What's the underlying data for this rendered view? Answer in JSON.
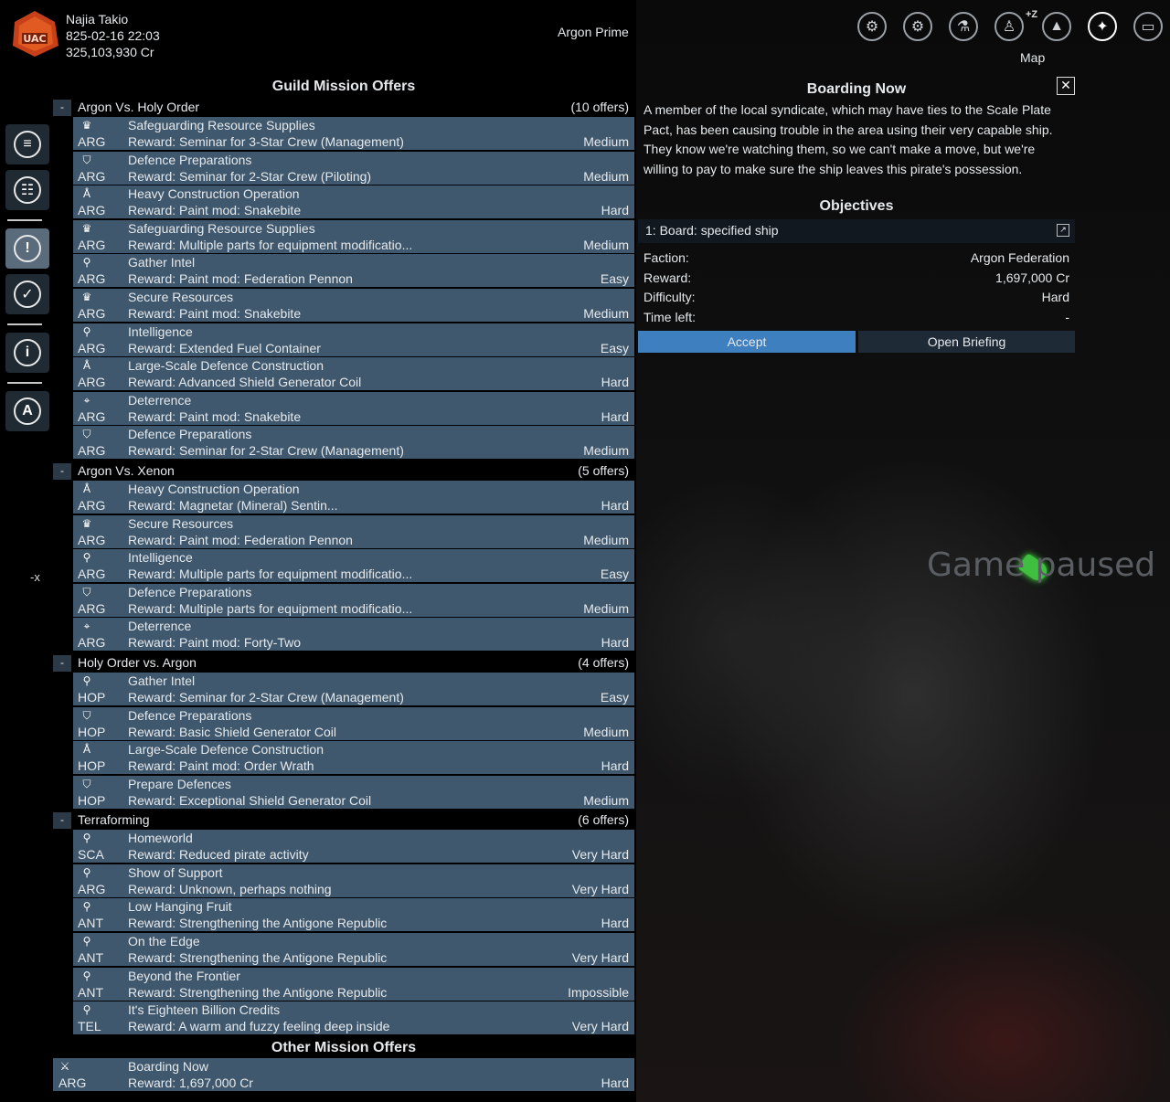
{
  "header": {
    "player_name": "Najia Takio",
    "datetime": "825-02-16 22:03",
    "credits": "325,103,930 Cr",
    "location": "Argon Prime",
    "map_label": "Map",
    "tz_label": "+Z"
  },
  "sidebar": {
    "x_label": "-x"
  },
  "guild": {
    "title": "Guild Mission Offers",
    "groups": [
      {
        "name": "Argon Vs. Holy Order",
        "count": "(10 offers)",
        "rows": [
          {
            "icon": "shield-crown",
            "name": "Safeguarding Resource Supplies",
            "faction": "ARG",
            "reward": "Reward: Seminar for 3-Star Crew (Management)",
            "difficulty": "Medium"
          },
          {
            "icon": "shield",
            "name": "Defence Preparations",
            "faction": "ARG",
            "reward": "Reward: Seminar for 2-Star Crew (Piloting)",
            "difficulty": "Medium"
          },
          {
            "icon": "build",
            "name": "Heavy Construction Operation",
            "faction": "ARG",
            "reward": "Reward: Paint mod: Snakebite",
            "difficulty": "Hard"
          },
          {
            "icon": "shield-crown",
            "name": "Safeguarding Resource Supplies",
            "faction": "ARG",
            "reward": "Reward: Multiple parts for equipment modificatio...",
            "difficulty": "Medium"
          },
          {
            "icon": "bulb",
            "name": "Gather Intel",
            "faction": "ARG",
            "reward": "Reward: Paint mod: Federation Pennon",
            "difficulty": "Easy"
          },
          {
            "icon": "shield-crown",
            "name": "Secure Resources",
            "faction": "ARG",
            "reward": "Reward: Paint mod: Snakebite",
            "difficulty": "Medium"
          },
          {
            "icon": "bulb",
            "name": "Intelligence",
            "faction": "ARG",
            "reward": "Reward: Extended Fuel Container",
            "difficulty": "Easy"
          },
          {
            "icon": "build",
            "name": "Large-Scale Defence Construction",
            "faction": "ARG",
            "reward": "Reward: Advanced Shield Generator Coil",
            "difficulty": "Hard"
          },
          {
            "icon": "crosshair",
            "name": "Deterrence",
            "faction": "ARG",
            "reward": "Reward: Paint mod: Snakebite",
            "difficulty": "Hard"
          },
          {
            "icon": "shield",
            "name": "Defence Preparations",
            "faction": "ARG",
            "reward": "Reward: Seminar for 2-Star Crew (Management)",
            "difficulty": "Medium"
          }
        ]
      },
      {
        "name": "Argon Vs. Xenon",
        "count": "(5 offers)",
        "rows": [
          {
            "icon": "build",
            "name": "Heavy Construction Operation",
            "faction": "ARG",
            "reward": "Reward: Magnetar (Mineral) Sentin...",
            "difficulty": "Hard"
          },
          {
            "icon": "shield-crown",
            "name": "Secure Resources",
            "faction": "ARG",
            "reward": "Reward: Paint mod: Federation Pennon",
            "difficulty": "Medium"
          },
          {
            "icon": "bulb",
            "name": "Intelligence",
            "faction": "ARG",
            "reward": "Reward: Multiple parts for equipment modificatio...",
            "difficulty": "Easy"
          },
          {
            "icon": "shield",
            "name": "Defence Preparations",
            "faction": "ARG",
            "reward": "Reward: Multiple parts for equipment modificatio...",
            "difficulty": "Medium"
          },
          {
            "icon": "crosshair",
            "name": "Deterrence",
            "faction": "ARG",
            "reward": "Reward: Paint mod: Forty-Two",
            "difficulty": "Hard"
          }
        ]
      },
      {
        "name": "Holy Order vs. Argon",
        "count": "(4 offers)",
        "rows": [
          {
            "icon": "bulb",
            "name": "Gather Intel",
            "faction": "HOP",
            "reward": "Reward: Seminar for 2-Star Crew (Management)",
            "difficulty": "Easy"
          },
          {
            "icon": "shield",
            "name": "Defence Preparations",
            "faction": "HOP",
            "reward": "Reward: Basic Shield Generator Coil",
            "difficulty": "Medium"
          },
          {
            "icon": "build",
            "name": "Large-Scale Defence Construction",
            "faction": "HOP",
            "reward": "Reward: Paint mod: Order Wrath",
            "difficulty": "Hard"
          },
          {
            "icon": "shield",
            "name": "Prepare Defences",
            "faction": "HOP",
            "reward": "Reward: Exceptional Shield Generator Coil",
            "difficulty": "Medium"
          }
        ]
      },
      {
        "name": "Terraforming",
        "count": "(6 offers)",
        "rows": [
          {
            "icon": "bulb",
            "name": "Homeworld",
            "faction": "SCA",
            "reward": "Reward: Reduced pirate activity",
            "difficulty": "Very Hard"
          },
          {
            "icon": "bulb",
            "name": "Show of Support",
            "faction": "ARG",
            "reward": "Reward: Unknown, perhaps nothing",
            "difficulty": "Very Hard"
          },
          {
            "icon": "bulb",
            "name": "Low Hanging Fruit",
            "faction": "ANT",
            "reward": "Reward: Strengthening the Antigone Republic",
            "difficulty": "Hard"
          },
          {
            "icon": "bulb",
            "name": "On the Edge",
            "faction": "ANT",
            "reward": "Reward: Strengthening the Antigone Republic",
            "difficulty": "Very Hard"
          },
          {
            "icon": "bulb",
            "name": "Beyond the Frontier",
            "faction": "ANT",
            "reward": "Reward: Strengthening the Antigone Republic",
            "difficulty": "Impossible"
          },
          {
            "icon": "bulb",
            "name": "It's Eighteen Billion Credits",
            "faction": "TEL",
            "reward": "Reward: A warm and fuzzy feeling deep inside",
            "difficulty": "Very Hard"
          }
        ]
      }
    ]
  },
  "other": {
    "title": "Other Mission Offers",
    "rows": [
      {
        "icon": "swords",
        "name": "Boarding Now",
        "faction": "ARG",
        "reward": "Reward: 1,697,000 Cr",
        "difficulty": "Hard"
      }
    ]
  },
  "detail": {
    "title": "Boarding Now",
    "description": "A member of the local syndicate, which may have ties to the Scale Plate Pact, has been causing trouble in the area using their very capable ship. They know we're watching them, so we can't make a move, but we're willing to pay to make sure the ship leaves this pirate's possession.",
    "objectives_title": "Objectives",
    "objective": "1: Board: specified ship",
    "faction_label": "Faction:",
    "faction_value": "Argon Federation",
    "reward_label": "Reward:",
    "reward_value": "1,697,000 Cr",
    "difficulty_label": "Difficulty:",
    "difficulty_value": "Hard",
    "time_label": "Time left:",
    "time_value": "-",
    "accept_label": "Accept",
    "briefing_label": "Open Briefing"
  },
  "status": {
    "paused_text": "Game paused"
  },
  "colors": {
    "row_bg": "#3f586d",
    "accept": "#3e7fbf",
    "logo": "#e0501e"
  }
}
